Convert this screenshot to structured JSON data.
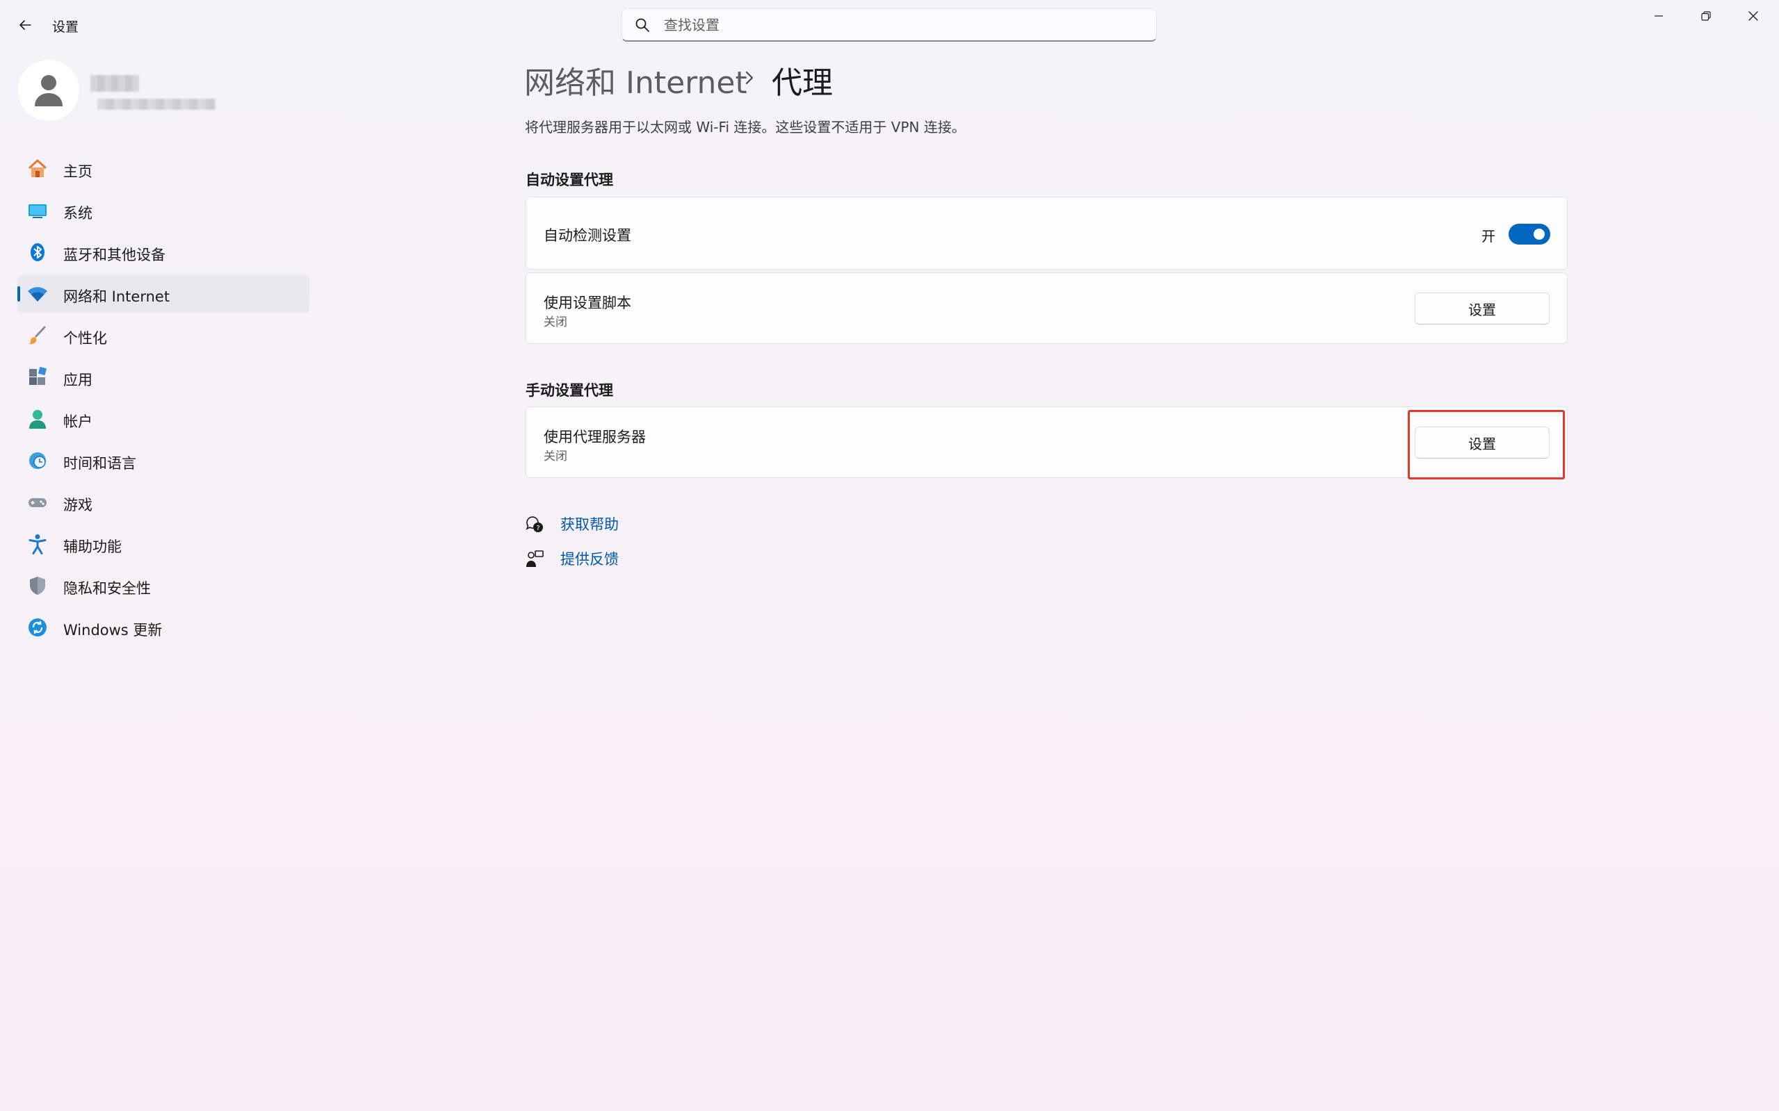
{
  "window": {
    "title": "设置",
    "search_placeholder": "查找设置"
  },
  "nav": [
    {
      "label": "主页",
      "icon": "home-icon"
    },
    {
      "label": "系统",
      "icon": "monitor-icon"
    },
    {
      "label": "蓝牙和其他设备",
      "icon": "bluetooth-icon"
    },
    {
      "label": "网络和 Internet",
      "icon": "wifi-icon",
      "active": true
    },
    {
      "label": "个性化",
      "icon": "brush-icon"
    },
    {
      "label": "应用",
      "icon": "apps-icon"
    },
    {
      "label": "帐户",
      "icon": "account-icon"
    },
    {
      "label": "时间和语言",
      "icon": "globe-clock-icon"
    },
    {
      "label": "游戏",
      "icon": "gamepad-icon"
    },
    {
      "label": "辅助功能",
      "icon": "accessibility-icon"
    },
    {
      "label": "隐私和安全性",
      "icon": "shield-icon"
    },
    {
      "label": "Windows 更新",
      "icon": "update-icon"
    }
  ],
  "breadcrumb": {
    "parent": "网络和 Internet",
    "current": "代理"
  },
  "description": "将代理服务器用于以太网或 Wi-Fi 连接。这些设置不适用于 VPN 连接。",
  "auto_section": {
    "title": "自动设置代理",
    "detect": {
      "label": "自动检测设置",
      "state": "开",
      "on": true
    },
    "script": {
      "label": "使用设置脚本",
      "status": "关闭",
      "button": "设置"
    }
  },
  "manual_section": {
    "title": "手动设置代理",
    "proxy": {
      "label": "使用代理服务器",
      "status": "关闭",
      "button": "设置"
    }
  },
  "links": {
    "help": "获取帮助",
    "feedback": "提供反馈"
  },
  "colors": {
    "accent": "#0067c0",
    "link": "#0057b0",
    "highlight": "#e5382b"
  }
}
